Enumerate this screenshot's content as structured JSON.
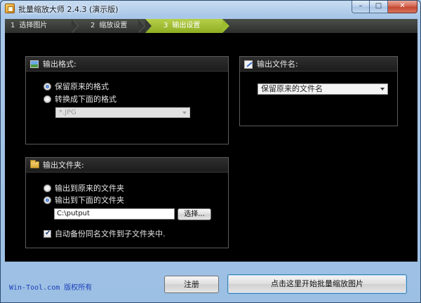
{
  "window": {
    "title": "批量缩放大师 2.4.3 (演示版)",
    "minimize_glyph": "–",
    "maximize_glyph": "□",
    "close_glyph": "✕"
  },
  "steps": [
    {
      "num": "1",
      "label": "选择图片",
      "active": false
    },
    {
      "num": "2",
      "label": "缩放设置",
      "active": false
    },
    {
      "num": "3",
      "label": "输出设置",
      "active": true
    }
  ],
  "output_format": {
    "title": "输出格式:",
    "icon": "image-icon",
    "option_keep": "保留原来的格式",
    "option_convert": "转换成下面的格式",
    "selected": "keep",
    "format_value": "*.JPG"
  },
  "output_filename": {
    "title": "输出文件名:",
    "icon": "pencil-icon",
    "select_value": "保留原来的文件名"
  },
  "output_folder": {
    "title": "输出文件夹:",
    "icon": "folder-icon",
    "option_original": "输出到原来的文件夹",
    "option_below": "输出到下面的文件夹",
    "selected": "below",
    "path_value": "C:\\putput",
    "browse_label": "选择...",
    "backup_checkbox_label": "自动备份同名文件到子文件夹中.",
    "backup_checked": true
  },
  "footer": {
    "site": "Win-Tool.com",
    "rights": "版权所有",
    "register_label": "注册",
    "start_label": "点击这里开始批量缩放图片"
  },
  "colors": {
    "active_step": "#9bbd2e",
    "content_bg": "#000000",
    "window_chrome": "#a9c7e8",
    "link": "#1a3fb8"
  }
}
